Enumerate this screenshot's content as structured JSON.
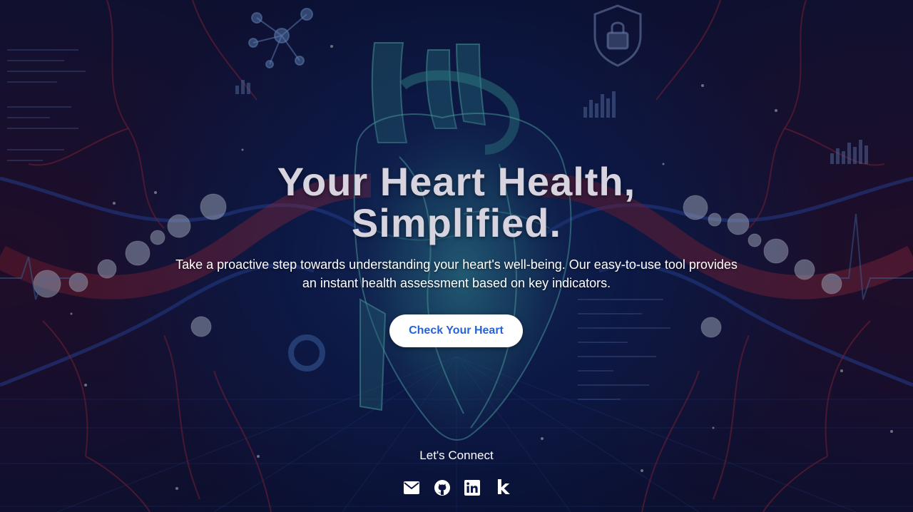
{
  "hero": {
    "headline_line1": "Your Heart Health,",
    "headline_line2": "Simplified.",
    "subtitle": "Take a proactive step towards understanding your heart's well-being. Our easy-to-use tool provides an instant health assessment based on key indicators.",
    "cta_label": "Check Your Heart"
  },
  "footer": {
    "connect_label": "Let's Connect",
    "socials": [
      {
        "icon": "envelope-icon",
        "label": "Email"
      },
      {
        "icon": "github-icon",
        "label": "GitHub"
      },
      {
        "icon": "linkedin-icon",
        "label": "LinkedIn"
      },
      {
        "icon": "kaggle-icon",
        "label": "Kaggle",
        "glyph": "k"
      }
    ]
  },
  "colors": {
    "cta_background": "#ffffff",
    "cta_text": "#2563d9",
    "headline": "#d7d3df",
    "page_background": "#0b1233"
  }
}
